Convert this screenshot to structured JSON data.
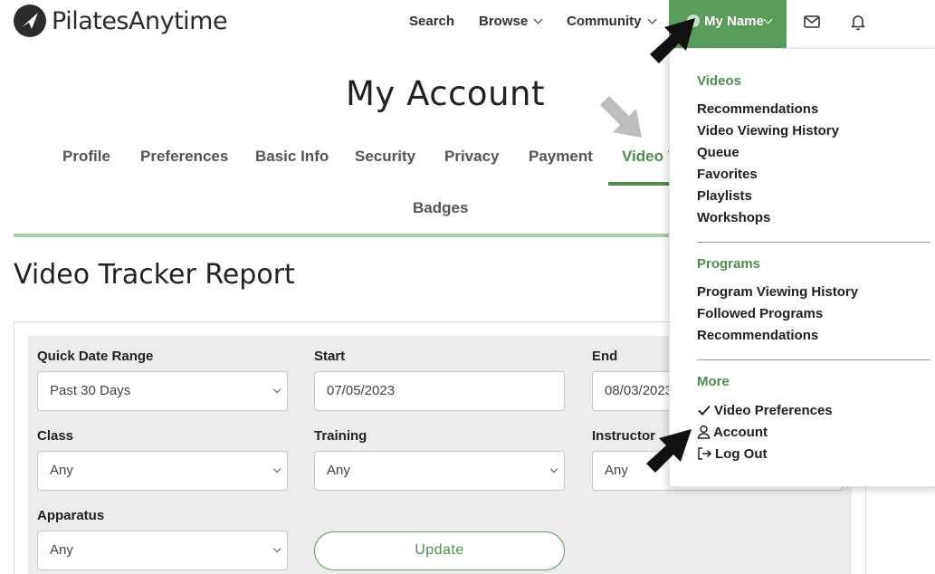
{
  "header": {
    "logo_text": "PilatesAnytime",
    "nav": {
      "search": "Search",
      "browse": "Browse",
      "community": "Community",
      "my_name": "My Name"
    }
  },
  "account": {
    "title": "My Account",
    "tabs": [
      "Profile",
      "Preferences",
      "Basic Info",
      "Security",
      "Privacy",
      "Payment",
      "Video T",
      "Badges"
    ],
    "active_tab": "Video T"
  },
  "report": {
    "title": "Video Tracker Report",
    "filters": {
      "quick_date_range": {
        "label": "Quick Date Range",
        "value": "Past 30 Days"
      },
      "start": {
        "label": "Start",
        "value": "07/05/2023"
      },
      "end": {
        "label": "End",
        "value": "08/03/2023"
      },
      "class": {
        "label": "Class",
        "value": "Any"
      },
      "training": {
        "label": "Training",
        "value": "Any"
      },
      "instructor": {
        "label": "Instructor",
        "value": "Any"
      },
      "apparatus": {
        "label": "Apparatus",
        "value": "Any"
      }
    },
    "update_label": "Update"
  },
  "menu": {
    "videos_heading": "Videos",
    "videos_items": [
      "Recommendations",
      "Video Viewing History",
      "Queue",
      "Favorites",
      "Playlists",
      "Workshops"
    ],
    "programs_heading": "Programs",
    "programs_items": [
      "Program Viewing History",
      "Followed Programs",
      "Recommendations"
    ],
    "more_heading": "More",
    "more_items": [
      "Video Preferences",
      "Account",
      "Log Out"
    ]
  },
  "colors": {
    "accent": "#5a9d5a",
    "accent_text": "#4e8e4e",
    "tab_rule": "#a9d1a9",
    "panel_bg": "#ececec"
  },
  "icons": [
    "logo-icon",
    "chevron-down-icon",
    "user-avatar-icon",
    "mail-icon",
    "bell-icon",
    "check-icon",
    "user-icon",
    "logout-icon",
    "pointer-arrow-icon"
  ]
}
